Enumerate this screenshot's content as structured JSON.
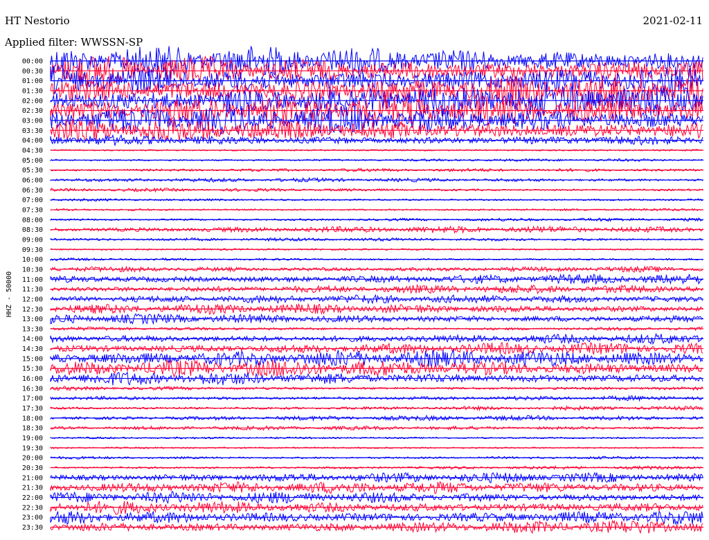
{
  "header": {
    "station": "HT Nestorio",
    "filter_label": "Applied filter: WWSSN-SP",
    "date": "2021-02-11"
  },
  "side_label": "HHZ - 50000",
  "chart_data": {
    "type": "line",
    "subtype": "helicorder",
    "title": "HT Nestorio",
    "date": "2021-02-11",
    "channel": "HHZ",
    "scale": 50000,
    "filter": "WWSSN-SP",
    "row_interval_minutes": 30,
    "colors": [
      "#0000ff",
      "#ff0033"
    ],
    "rows": [
      {
        "time": "00:00",
        "amplitude": 0.9
      },
      {
        "time": "00:30",
        "amplitude": 0.9
      },
      {
        "time": "01:00",
        "amplitude": 0.95
      },
      {
        "time": "01:30",
        "amplitude": 1.0
      },
      {
        "time": "02:00",
        "amplitude": 0.95
      },
      {
        "time": "02:30",
        "amplitude": 0.9
      },
      {
        "time": "03:00",
        "amplitude": 0.85
      },
      {
        "time": "03:30",
        "amplitude": 0.7
      },
      {
        "time": "04:00",
        "amplitude": 0.35
      },
      {
        "time": "04:30",
        "amplitude": 0.05
      },
      {
        "time": "05:00",
        "amplitude": 0.08
      },
      {
        "time": "05:30",
        "amplitude": 0.1
      },
      {
        "time": "06:00",
        "amplitude": 0.12
      },
      {
        "time": "06:30",
        "amplitude": 0.1
      },
      {
        "time": "07:00",
        "amplitude": 0.08
      },
      {
        "time": "07:30",
        "amplitude": 0.08
      },
      {
        "time": "08:00",
        "amplitude": 0.1
      },
      {
        "time": "08:30",
        "amplitude": 0.2
      },
      {
        "time": "09:00",
        "amplitude": 0.1
      },
      {
        "time": "09:30",
        "amplitude": 0.05
      },
      {
        "time": "10:00",
        "amplitude": 0.08
      },
      {
        "time": "10:30",
        "amplitude": 0.2
      },
      {
        "time": "11:00",
        "amplitude": 0.3
      },
      {
        "time": "11:30",
        "amplitude": 0.25
      },
      {
        "time": "12:00",
        "amplitude": 0.25
      },
      {
        "time": "12:30",
        "amplitude": 0.3
      },
      {
        "time": "13:00",
        "amplitude": 0.3
      },
      {
        "time": "13:30",
        "amplitude": 0.12
      },
      {
        "time": "14:00",
        "amplitude": 0.3
      },
      {
        "time": "14:30",
        "amplitude": 0.35
      },
      {
        "time": "15:00",
        "amplitude": 0.5
      },
      {
        "time": "15:30",
        "amplitude": 0.5
      },
      {
        "time": "16:00",
        "amplitude": 0.4
      },
      {
        "time": "16:30",
        "amplitude": 0.12
      },
      {
        "time": "17:00",
        "amplitude": 0.15
      },
      {
        "time": "17:30",
        "amplitude": 0.12
      },
      {
        "time": "18:00",
        "amplitude": 0.15
      },
      {
        "time": "18:30",
        "amplitude": 0.12
      },
      {
        "time": "19:00",
        "amplitude": 0.06
      },
      {
        "time": "19:30",
        "amplitude": 0.05
      },
      {
        "time": "20:00",
        "amplitude": 0.1
      },
      {
        "time": "20:30",
        "amplitude": 0.1
      },
      {
        "time": "21:00",
        "amplitude": 0.3
      },
      {
        "time": "21:30",
        "amplitude": 0.35
      },
      {
        "time": "22:00",
        "amplitude": 0.35
      },
      {
        "time": "22:30",
        "amplitude": 0.4
      },
      {
        "time": "23:00",
        "amplitude": 0.45
      },
      {
        "time": "23:30",
        "amplitude": 0.4
      }
    ]
  }
}
